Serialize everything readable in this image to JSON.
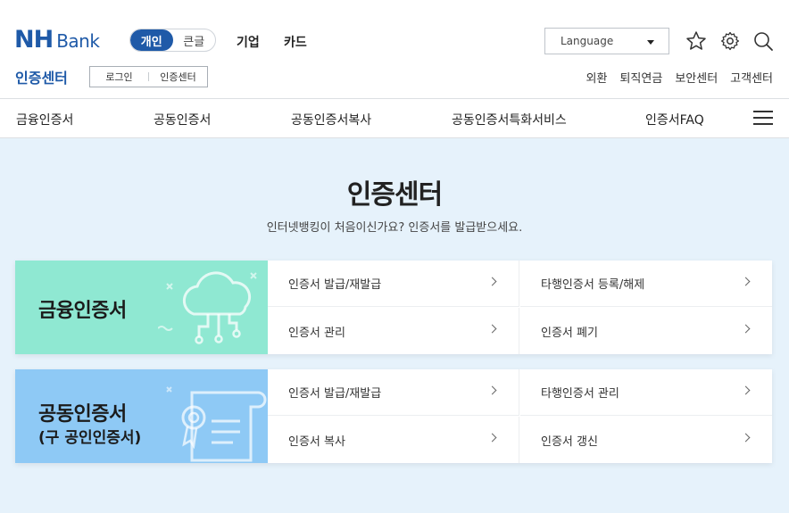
{
  "header": {
    "logo_nh": "NH",
    "logo_bank": "Bank",
    "mode_personal": "개인",
    "mode_large": "큰글",
    "link_business": "기업",
    "link_card": "카드",
    "language_label": "Language",
    "center_title": "인증센터",
    "sub_login": "로그인",
    "sub_center": "인증센터",
    "util_links": [
      "외환",
      "퇴직연금",
      "보안센터",
      "고객센터"
    ]
  },
  "nav": {
    "items": [
      "금융인증서",
      "공동인증서",
      "공동인증서복사",
      "공동인증서특화서비스",
      "인증서FAQ"
    ]
  },
  "main": {
    "title": "인증센터",
    "subtitle": "인터넷뱅킹이 처음이신가요? 인증서를 발급받으세요."
  },
  "cards": [
    {
      "title": "금융인증서",
      "subtitle": "",
      "links": [
        "인증서 발급/재발급",
        "타행인증서 등록/해제",
        "인증서 관리",
        "인증서 폐기"
      ]
    },
    {
      "title": "공동인증서",
      "subtitle": "(구 공인인증서)",
      "links": [
        "인증서 발급/재발급",
        "타행인증서 관리",
        "인증서 복사",
        "인증서 갱신"
      ]
    }
  ],
  "colors": {
    "brand": "#1f5aa8",
    "financial_banner": "#8fe8d2",
    "joint_banner": "#8ec9f5",
    "background": "#e6f2fb"
  }
}
